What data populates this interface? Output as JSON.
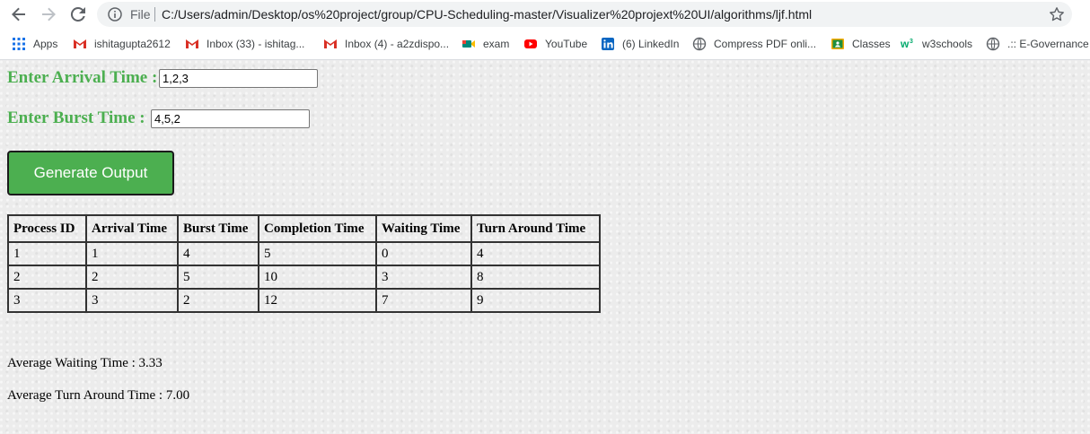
{
  "browser": {
    "scheme_label": "File",
    "url": "C:/Users/admin/Desktop/os%20project/group/CPU-Scheduling-master/Visualizer%20projext%20UI/algorithms/ljf.html",
    "bookmarks": [
      {
        "label": "Apps",
        "icon": "apps-grid-icon",
        "color": "#1a73e8"
      },
      {
        "label": "ishitagupta2612",
        "icon": "gmail-icon",
        "color": "#d93025"
      },
      {
        "label": "Inbox (33) - ishitag...",
        "icon": "gmail-icon",
        "color": "#d93025"
      },
      {
        "label": "Inbox (4) - a2zdispo...",
        "icon": "gmail-icon",
        "color": "#d93025"
      },
      {
        "label": "exam",
        "icon": "meet-icon",
        "color": "#00897b"
      },
      {
        "label": "YouTube",
        "icon": "youtube-icon",
        "color": "#ff0000"
      },
      {
        "label": "(6) LinkedIn",
        "icon": "linkedin-icon",
        "color": "#0a66c2"
      },
      {
        "label": "Compress PDF onli...",
        "icon": "globe-icon",
        "color": "#5f6368"
      },
      {
        "label": "Classes",
        "icon": "classroom-icon",
        "color": "#f9ab00"
      },
      {
        "label": "w3schools",
        "icon": "w3schools-icon",
        "color": "#04aa6d"
      },
      {
        "label": ".:: E-Governance ::",
        "icon": "globe-icon",
        "color": "#5f6368"
      }
    ]
  },
  "form": {
    "arrival_label": "Enter Arrival Time :",
    "arrival_value": "1,2,3",
    "burst_label": "Enter Burst Time :",
    "burst_value": "4,5,2",
    "generate_label": "Generate Output"
  },
  "table": {
    "headers": [
      "Process ID",
      "Arrival Time",
      "Burst Time",
      "Completion Time",
      "Waiting Time",
      "Turn Around Time"
    ],
    "rows": [
      [
        "1",
        "1",
        "4",
        "5",
        "0",
        "4"
      ],
      [
        "2",
        "2",
        "5",
        "10",
        "3",
        "8"
      ],
      [
        "3",
        "3",
        "2",
        "12",
        "7",
        "9"
      ]
    ]
  },
  "results": {
    "avg_waiting": "Average Waiting Time : 3.33",
    "avg_turnaround": "Average Turn Around Time : 7.00"
  },
  "colors": {
    "accent_green": "#4caf50"
  }
}
